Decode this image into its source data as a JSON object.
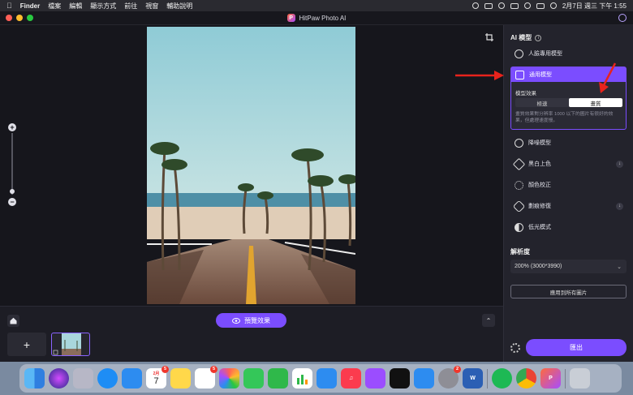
{
  "menubar": {
    "app": "Finder",
    "items": [
      "檔案",
      "編輯",
      "顯示方式",
      "前往",
      "視窗",
      "輔助說明"
    ],
    "datetime": "2月7日 週三 下午 1:55"
  },
  "window": {
    "title": "HitPaw Photo AI"
  },
  "canvas": {
    "preview_label": "預覽效果"
  },
  "panel": {
    "title": "AI 模型",
    "models": [
      {
        "label": "人臉專用模型",
        "icon": "face-icon"
      },
      {
        "label": "通用模型",
        "icon": "image-icon"
      },
      {
        "label": "降噪模型",
        "icon": "denoise-icon"
      },
      {
        "label": "黑白上色",
        "icon": "brush-icon"
      },
      {
        "label": "顏色校正",
        "icon": "sun-icon"
      },
      {
        "label": "劃痕修復",
        "icon": "bandage-icon"
      },
      {
        "label": "低光模式",
        "icon": "contrast-icon"
      }
    ],
    "effect_label": "模型效果",
    "effect_options": [
      "極速",
      "畫質"
    ],
    "effect_selected": "畫質",
    "effect_desc": "畫質效果對分辨率 1000 以下的圖片有很好的效果，但處理速度慢。",
    "resolution_title": "解析度",
    "resolution_value": "200% (3000*3990)",
    "apply_all": "應用到所有圖片",
    "export": "匯出"
  },
  "dock": {
    "apps": [
      "Finder",
      "Siri",
      "Launchpad",
      "Safari",
      "Mail",
      "Calendar",
      "Notes",
      "Reminders",
      "Photos",
      "Messages",
      "FaceTime",
      "Numbers",
      "Keynote",
      "Music",
      "Podcasts",
      "TV",
      "App Store",
      "System Settings",
      "Word",
      "Spotify",
      "Chrome",
      "HitPaw",
      "Trash"
    ],
    "calendar_day": "7",
    "calendar_month": "2月",
    "badges": {
      "calendar": "5",
      "reminders": "5",
      "system_settings": "2"
    }
  },
  "colors": {
    "accent": "#7b4dff",
    "annotation": "#e8231c"
  }
}
